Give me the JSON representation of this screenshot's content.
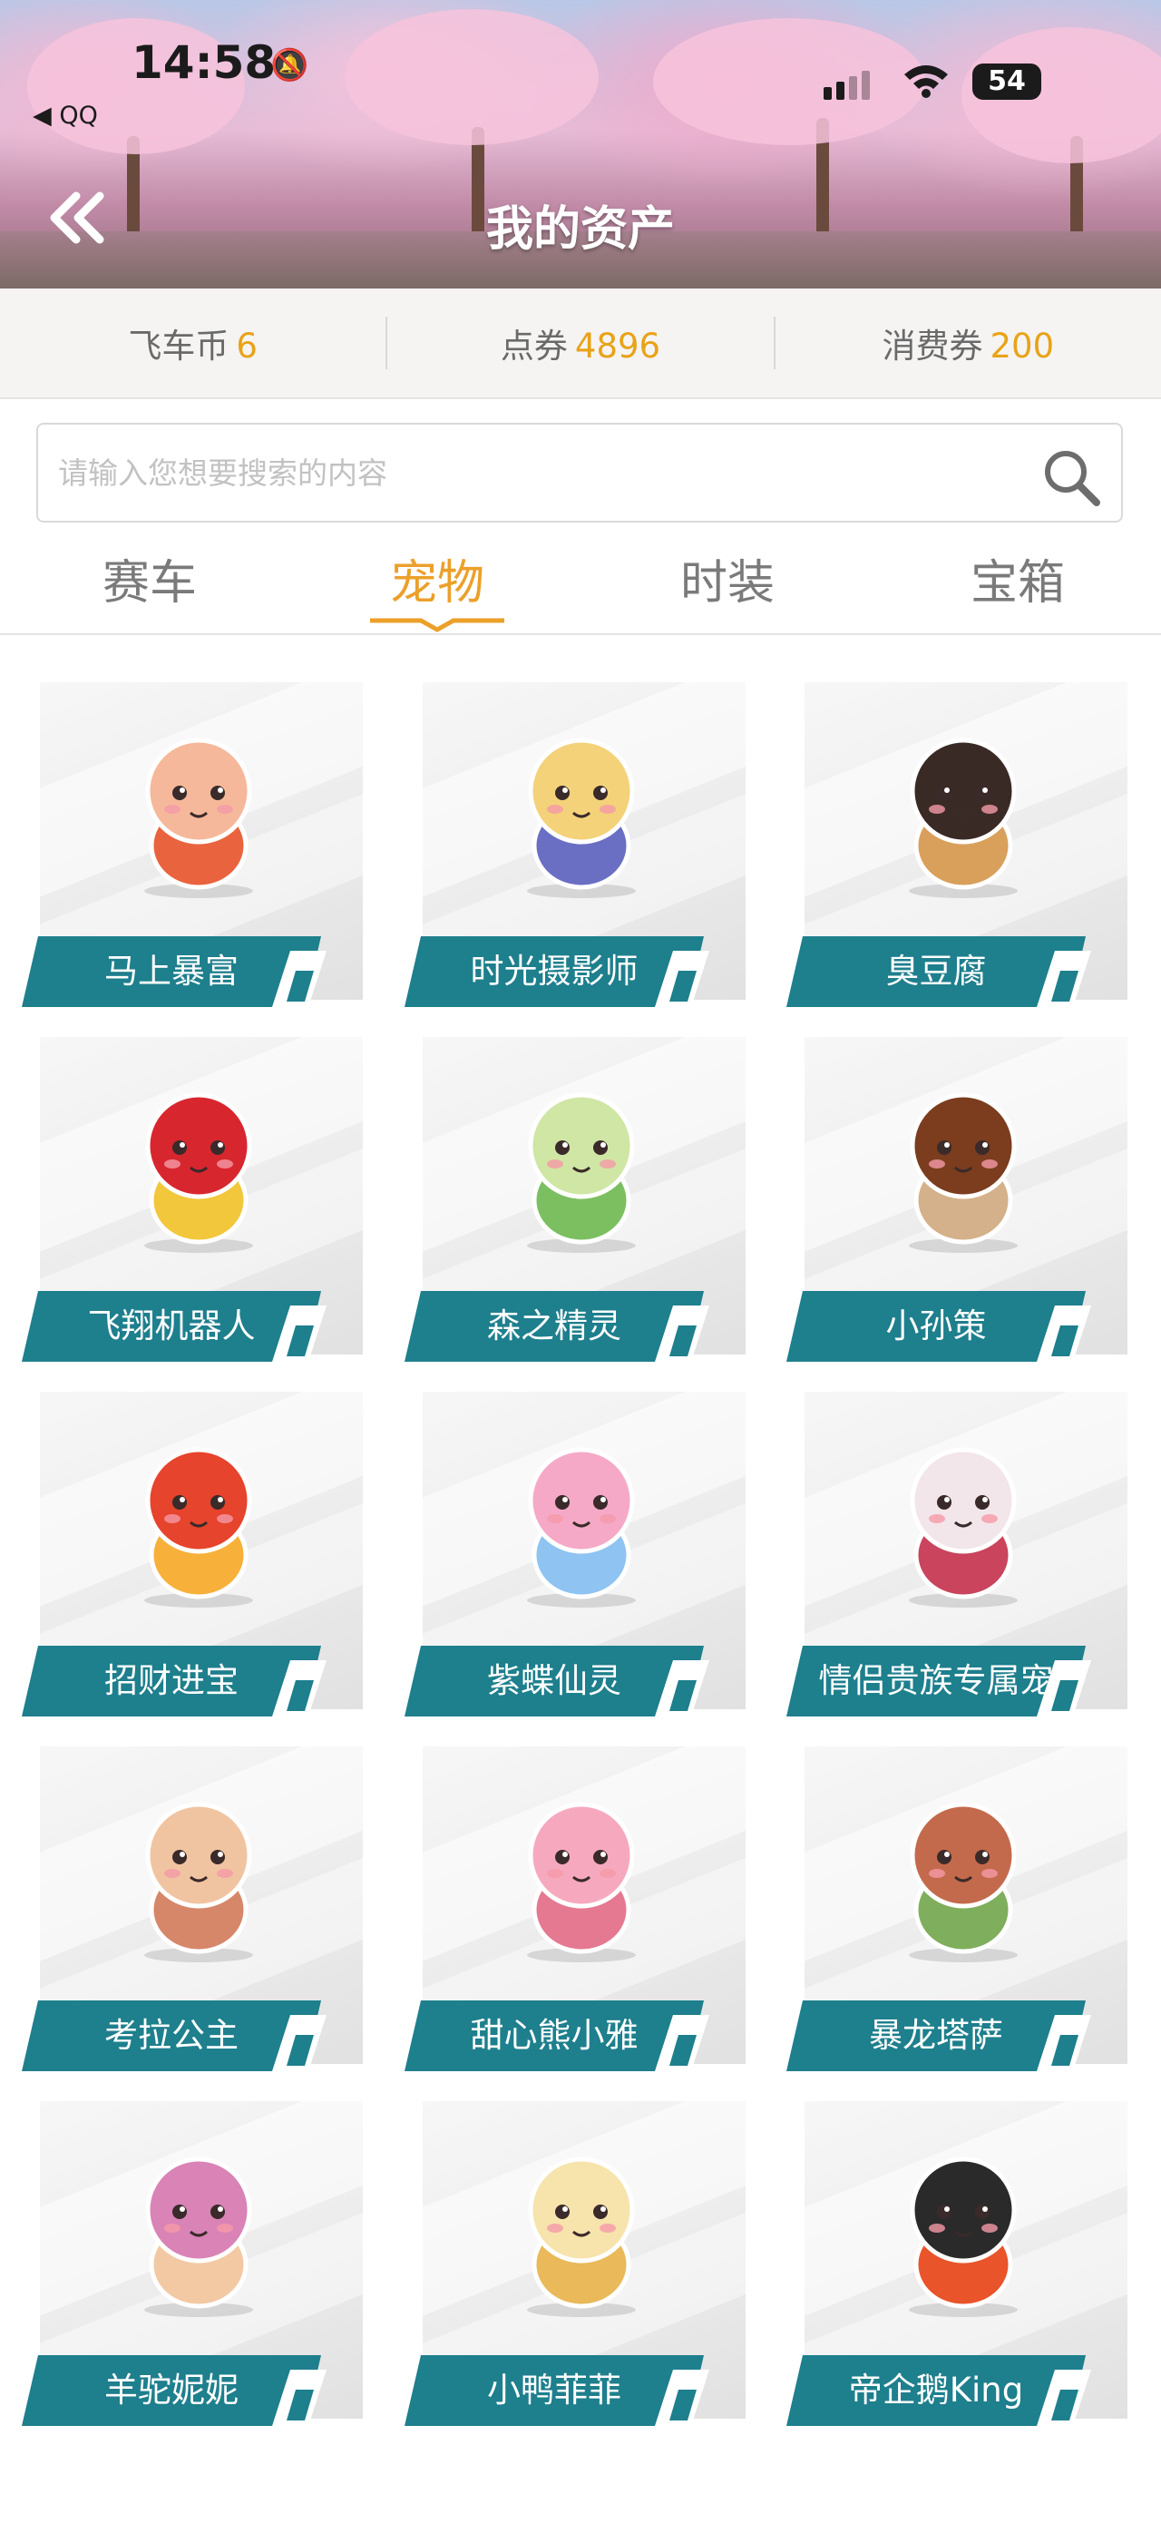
{
  "status_bar": {
    "time": "14:58",
    "back_app": "◀ QQ",
    "battery": "54"
  },
  "header": {
    "title": "我的资产"
  },
  "currency": [
    {
      "label": "飞车币",
      "value": "6"
    },
    {
      "label": "点券",
      "value": "4896"
    },
    {
      "label": "消费券",
      "value": "200"
    }
  ],
  "search": {
    "placeholder": "请输入您想要搜索的内容"
  },
  "tabs": [
    {
      "label": "赛车",
      "active": false
    },
    {
      "label": "宠物",
      "active": true
    },
    {
      "label": "时装",
      "active": false
    },
    {
      "label": "宝箱",
      "active": false
    }
  ],
  "pets": [
    {
      "name": "马上暴富"
    },
    {
      "name": "时光摄影师"
    },
    {
      "name": "臭豆腐"
    },
    {
      "name": "飞翔机器人"
    },
    {
      "name": "森之精灵"
    },
    {
      "name": "小孙策"
    },
    {
      "name": "招财进宝"
    },
    {
      "name": "紫蝶仙灵"
    },
    {
      "name": "情侣贵族专属宠"
    },
    {
      "name": "考拉公主"
    },
    {
      "name": "甜心熊小雅"
    },
    {
      "name": "暴龙塔萨"
    },
    {
      "name": "羊驼妮妮"
    },
    {
      "name": "小鸭菲菲"
    },
    {
      "name": "帝企鹅King"
    }
  ],
  "colors": {
    "accent": "#eca02a",
    "value": "#e8a317",
    "label_bg": "#1e7f8d"
  }
}
